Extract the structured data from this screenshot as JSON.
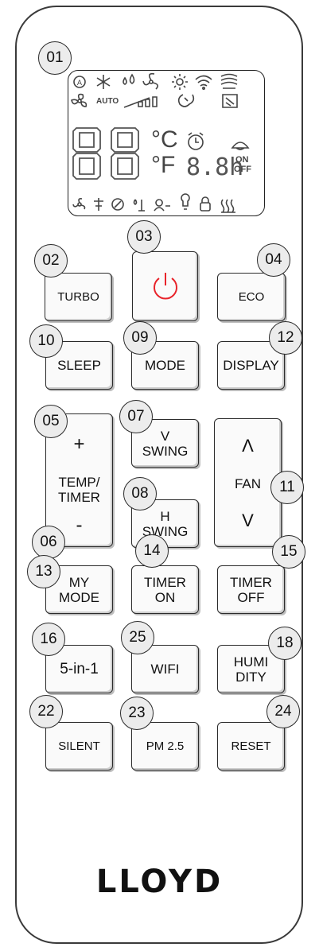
{
  "lcd": {
    "digits": "88",
    "unit_c": "°C",
    "unit_f": "°F",
    "auto_text": "AUTO",
    "timer_text": "8.8h",
    "on_text": "ON",
    "off_text": "OFF",
    "icons_top": [
      "auto-mode-icon",
      "cool-snowflake-icon",
      "dry-drops-icon",
      "fan-mode-icon",
      "heat-sun-icon",
      "wifi-icon",
      "swing-vane-icon"
    ],
    "icons_row2": [
      "fan-speed-icon",
      "signal-bars-icon",
      "turbo-muscle-icon",
      "vane-position-icon"
    ],
    "icons_bottom": [
      "fan-icon",
      "health-icon",
      "clean-icon",
      "humidity-icon",
      "person-icon",
      "light-icon",
      "lock-icon",
      "heater-icon"
    ]
  },
  "buttons": {
    "turbo": "TURBO",
    "eco": "ECO",
    "sleep": "SLEEP",
    "mode": "MODE",
    "display": "DISPLAY",
    "temp_plus": "+",
    "temp_label": "TEMP/\nTIMER",
    "temp_minus": "-",
    "v_swing": "V\nSWING",
    "h_swing": "H\nSWING",
    "fan_up": "Λ",
    "fan_label": "FAN",
    "fan_down": "V",
    "my_mode": "MY\nMODE",
    "timer_on": "TIMER\nON",
    "timer_off": "TIMER\nOFF",
    "five_in_one": "5-in-1",
    "wifi": "WIFI",
    "humidity": "HUMI\nDITY",
    "silent": "SILENT",
    "pm25": "PM 2.5",
    "reset": "RESET"
  },
  "callouts": {
    "c01": "01",
    "c02": "02",
    "c03": "03",
    "c04": "04",
    "c05": "05",
    "c06": "06",
    "c07": "07",
    "c08": "08",
    "c09": "09",
    "c10": "10",
    "c11": "11",
    "c12": "12",
    "c13": "13",
    "c14": "14",
    "c15": "15",
    "c16": "16",
    "c18": "18",
    "c22": "22",
    "c23": "23",
    "c24": "24",
    "c25": "25"
  },
  "brand": "LLOYD",
  "colors": {
    "power": "#e8232a",
    "outline": "#2b2b2b",
    "callout_fill": "#ececec"
  }
}
